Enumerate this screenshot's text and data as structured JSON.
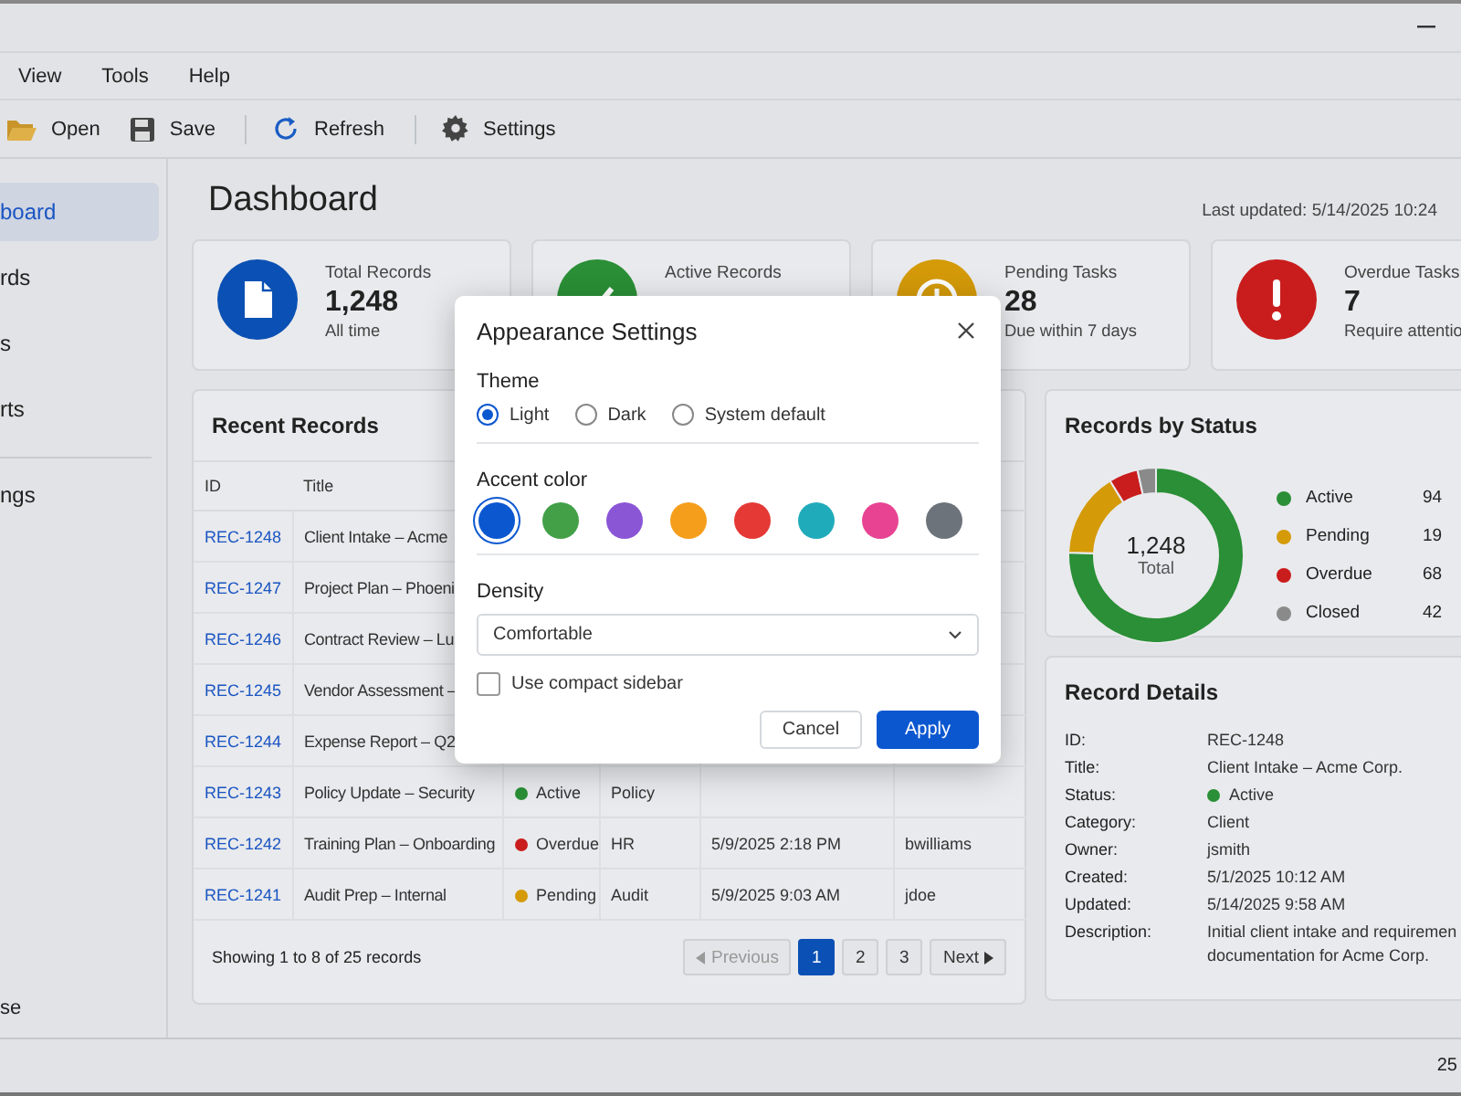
{
  "menu": [
    "View",
    "Tools",
    "Help"
  ],
  "toolbar": [
    {
      "kind": "open",
      "label": "Open"
    },
    {
      "kind": "save",
      "label": "Save"
    },
    {
      "kind": "refresh",
      "label": "Refresh"
    },
    {
      "kind": "settings",
      "label": "Settings"
    }
  ],
  "sidebar": {
    "items": [
      {
        "label": "board",
        "selected": true
      },
      {
        "label": "rds",
        "selected": false
      },
      {
        "label": "s",
        "selected": false
      },
      {
        "label": "rts",
        "selected": false
      },
      {
        "label": "ngs",
        "selected": false
      }
    ],
    "footer": "se"
  },
  "page": {
    "title": "Dashboard",
    "last_updated": "Last updated: 5/14/2025 10:24"
  },
  "stats": [
    {
      "kind": "document",
      "color": "#0b50b4",
      "label": "Total Records",
      "value": "1,248",
      "note": "All time"
    },
    {
      "kind": "check",
      "color": "#2a8f36",
      "label": "Active Records"
    },
    {
      "kind": "clock",
      "color": "#d49a08",
      "label": "Pending Tasks",
      "value": "28",
      "note": "Due within 7 days"
    },
    {
      "kind": "alert",
      "color": "#c91d1d",
      "label": "Overdue Tasks",
      "value": "7",
      "note": "Require attentio"
    }
  ],
  "recent": {
    "title": "Recent Records",
    "columns": [
      "ID",
      "Title"
    ],
    "rows": [
      {
        "id": "REC-1248",
        "title": "Client Intake – Acme"
      },
      {
        "id": "REC-1247",
        "title": "Project Plan – Phoeni"
      },
      {
        "id": "REC-1246",
        "title": "Contract Review – Lu"
      },
      {
        "id": "REC-1245",
        "title": "Vendor Assessment –"
      },
      {
        "id": "REC-1244",
        "title": "Expense Report – Q2"
      },
      {
        "id": "REC-1243",
        "title": "Policy Update – Security",
        "status": "Active",
        "color": "#2a8f36",
        "category": "Policy"
      },
      {
        "id": "REC-1242",
        "title": "Training Plan – Onboarding",
        "status": "Overdue",
        "color": "#c91d1d",
        "category": "HR",
        "date": "5/9/2025 2:18 PM",
        "owner": "bwilliams"
      },
      {
        "id": "REC-1241",
        "title": "Audit Prep – Internal",
        "status": "Pending",
        "color": "#d49a08",
        "category": "Audit",
        "date": "5/9/2025 9:03 AM",
        "owner": "jdoe"
      }
    ],
    "summary": "Showing 1 to 8 of 25 records",
    "pager": {
      "previous": "Previous",
      "next": "Next",
      "pages": [
        {
          "label": "1",
          "selected": true
        },
        {
          "label": "2",
          "selected": false
        },
        {
          "label": "3",
          "selected": false
        }
      ]
    }
  },
  "by_status": {
    "title": "Records by Status",
    "total": "1,248",
    "total_label": "Total",
    "chart_data": {
      "type": "donut",
      "categories": [
        "Active",
        "Pending",
        "Overdue",
        "Closed"
      ],
      "values": [
        75.5,
        15.7,
        5.4,
        3.4
      ]
    },
    "legend": [
      {
        "value": "94",
        "color": "#2a8f36"
      },
      {
        "value": "19",
        "color": "#d49a08"
      },
      {
        "value": "68",
        "color": "#c91d1d"
      },
      {
        "value": "42",
        "color": "#8a8a8a"
      }
    ]
  },
  "details": {
    "title": "Record Details",
    "fields": [
      {
        "label": "ID:",
        "lines": [
          "REC-1248"
        ]
      },
      {
        "label": "Title:",
        "lines": [
          "Client Intake – Acme Corp."
        ]
      },
      {
        "label": "Status:",
        "lines": [
          "Active"
        ],
        "color": "#2a8f36"
      },
      {
        "label": "Category:",
        "lines": [
          "Client"
        ]
      },
      {
        "label": "Owner:",
        "lines": [
          "jsmith"
        ]
      },
      {
        "label": "Created:",
        "lines": [
          "5/1/2025 10:12 AM"
        ]
      },
      {
        "label": "Updated:",
        "lines": [
          "5/14/2025 9:58 AM"
        ]
      },
      {
        "label": "Description:",
        "lines": [
          "Initial client intake and requiremen",
          "documentation for Acme Corp."
        ]
      }
    ]
  },
  "status_bar": "25",
  "dialog": {
    "title": "Appearance Settings",
    "theme_label": "Theme",
    "themes": [
      {
        "label": "Light",
        "selected": true
      },
      {
        "label": "Dark",
        "selected": false
      },
      {
        "label": "System default",
        "selected": false
      }
    ],
    "accent_label": "Accent color",
    "accents": [
      {
        "color": "#0b57d0",
        "selected": true
      },
      {
        "color": "#43a047",
        "selected": false
      },
      {
        "color": "#8a56d6",
        "selected": false
      },
      {
        "color": "#f59e1b",
        "selected": false
      },
      {
        "color": "#e53935",
        "selected": false
      },
      {
        "color": "#20abbb",
        "selected": false
      },
      {
        "color": "#e84393",
        "selected": false
      },
      {
        "color": "#6c737b",
        "selected": false
      }
    ],
    "density_label": "Density",
    "density": "Comfortable",
    "compact": {
      "label": "Use compact sidebar",
      "checked": false
    },
    "buttons": [
      {
        "kind": "secondary",
        "label": "Cancel"
      },
      {
        "kind": "primary",
        "label": "Apply"
      }
    ]
  }
}
